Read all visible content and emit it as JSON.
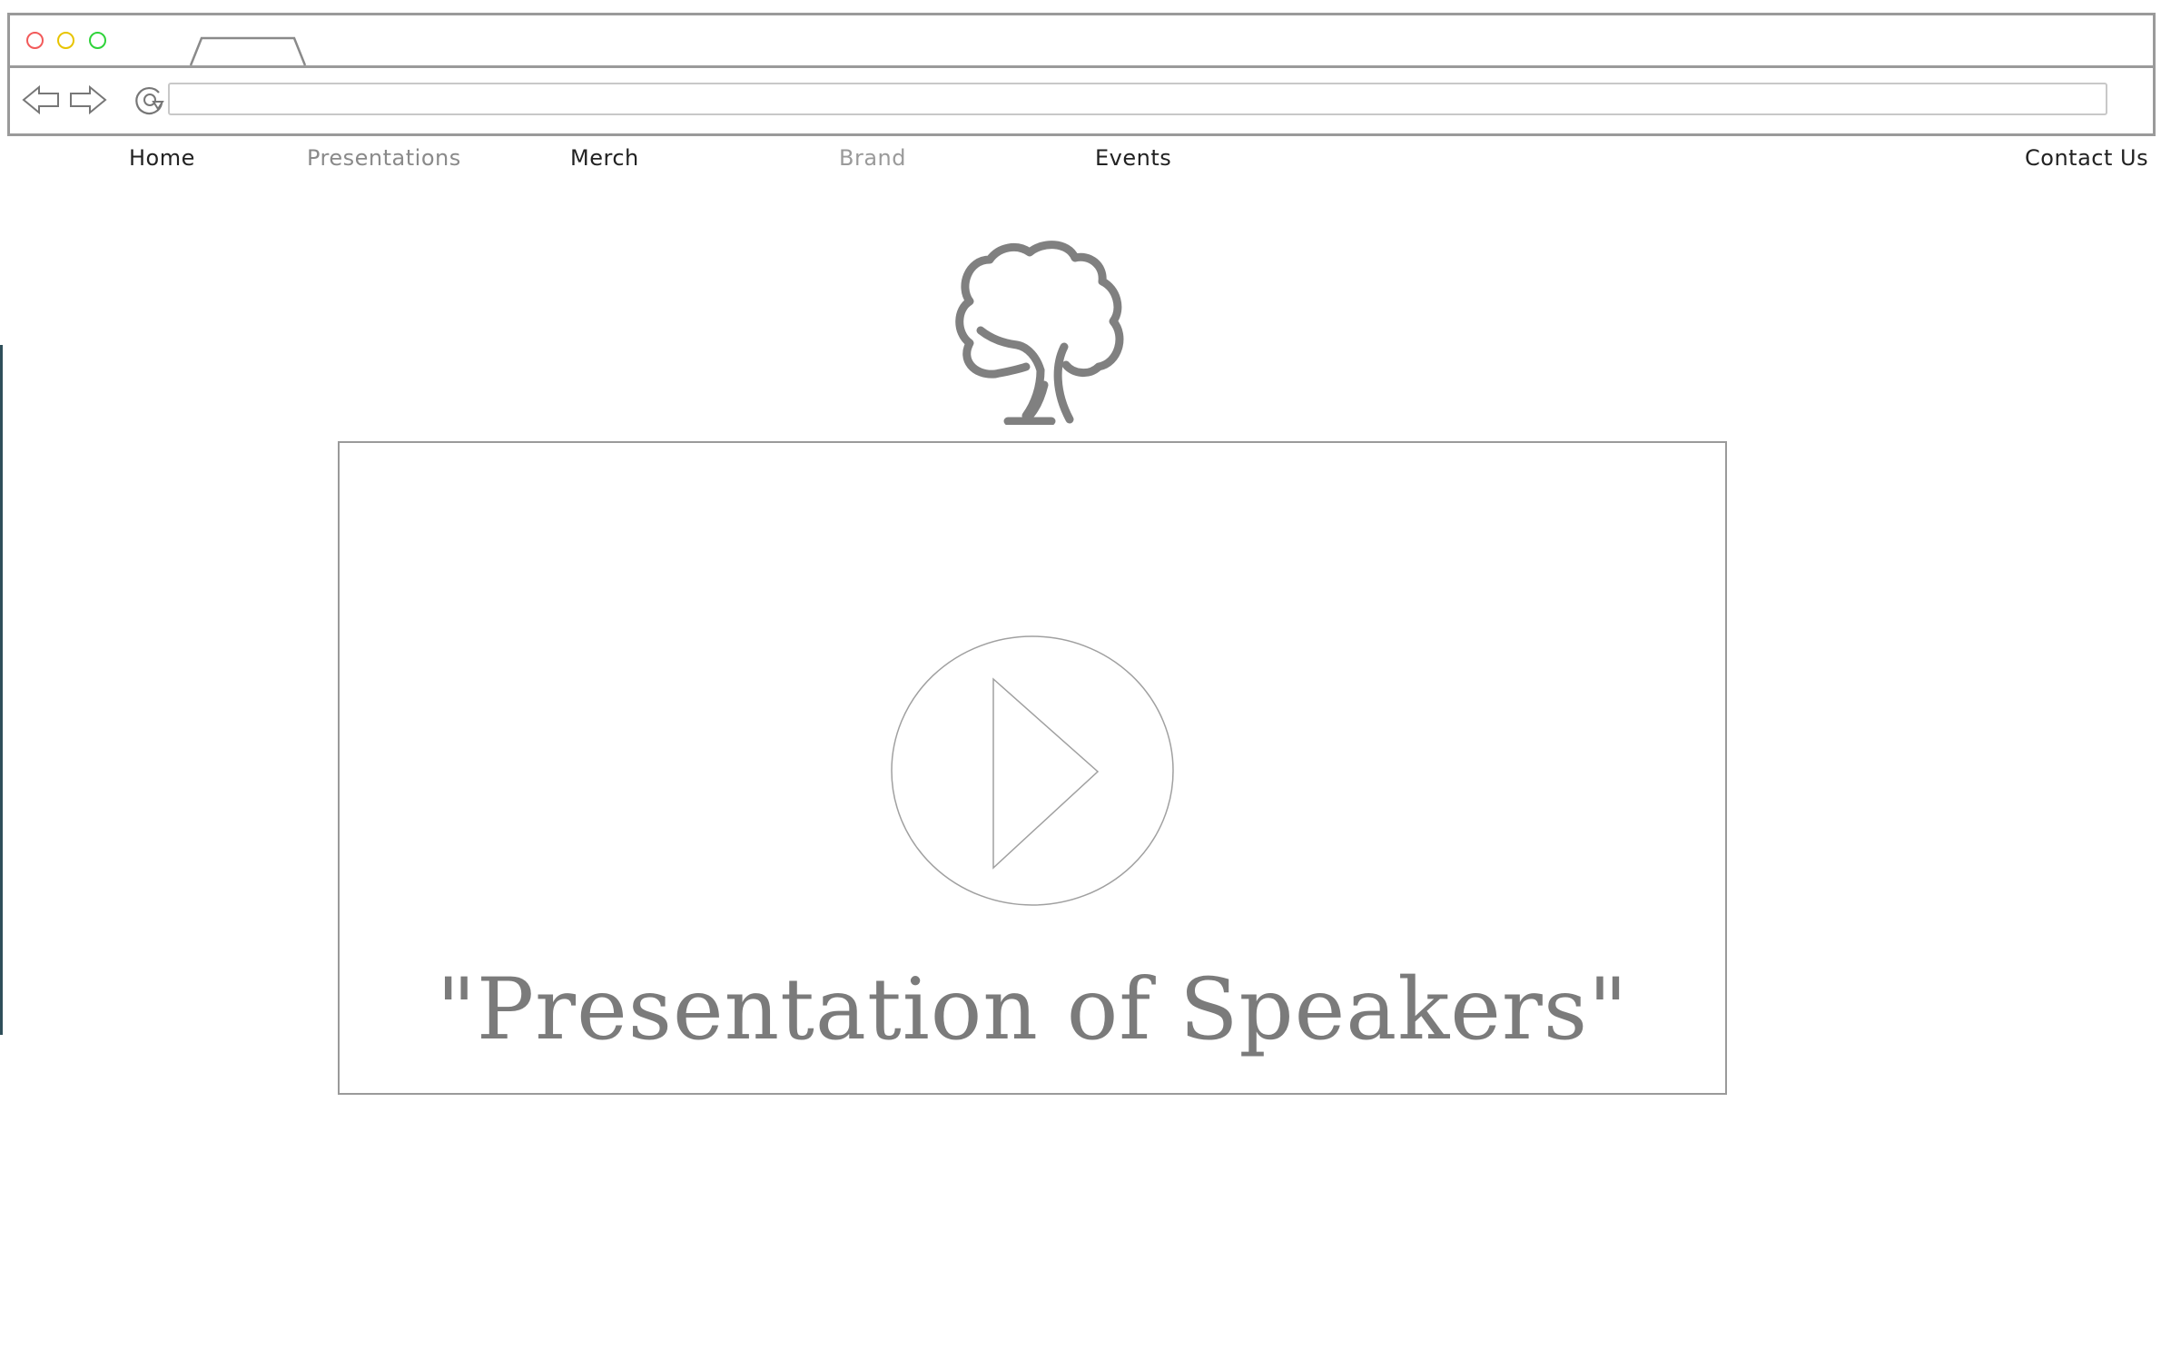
{
  "browser": {
    "address_value": "",
    "window_controls": [
      "close",
      "minimize",
      "maximize"
    ]
  },
  "site_nav": {
    "items": [
      {
        "label": "Home"
      },
      {
        "label": "Presentations"
      },
      {
        "label": "Merch"
      },
      {
        "label": "Brand"
      },
      {
        "label": "Events"
      },
      {
        "label": "Contact Us"
      }
    ]
  },
  "logo": {
    "icon": "tree-icon"
  },
  "video": {
    "caption": "\"Presentation of Speakers\"",
    "play_icon": "play-icon"
  },
  "colors": {
    "frame_border": "#9a9a9a",
    "traffic_close": "#f25a5a",
    "traffic_minimize": "#e8c400",
    "traffic_maximize": "#2fd33a",
    "caption_text": "#7b7b7b",
    "logo": "#808080"
  }
}
